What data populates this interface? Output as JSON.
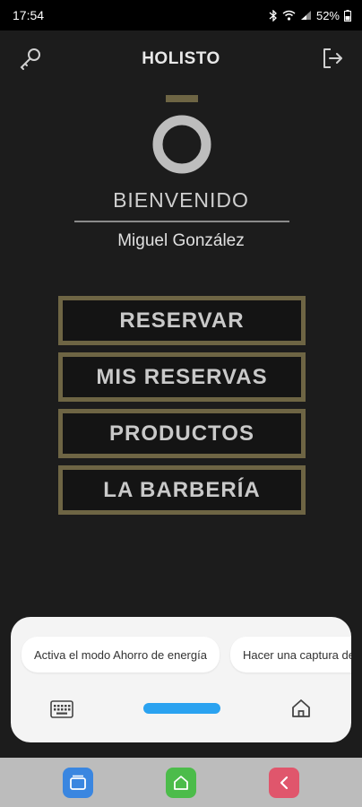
{
  "status_bar": {
    "time": "17:54",
    "battery": "52%",
    "icons": [
      "bluetooth-icon",
      "wifi-icon",
      "signal-icon",
      "battery-icon"
    ]
  },
  "app_bar": {
    "title": "HOLISTO",
    "left_icon": "key-icon",
    "right_icon": "logout-icon"
  },
  "brand": {
    "logo_icon": "holisto-logo",
    "accent_color": "#6e6544"
  },
  "welcome": {
    "heading": "BIENVENIDO",
    "user_name": "Miguel González"
  },
  "menu": {
    "items": [
      {
        "label": "RESERVAR"
      },
      {
        "label": "MIS RESERVAS"
      },
      {
        "label": "PRODUCTOS"
      },
      {
        "label": "LA BARBERÍA"
      }
    ]
  },
  "suggestion_panel": {
    "chips": [
      {
        "label": "Activa el modo Ahorro de energía"
      },
      {
        "label": "Hacer una captura de pantalla"
      }
    ],
    "keyboard_icon": "keyboard-icon",
    "home_icon": "home-icon"
  },
  "system_nav": {
    "buttons": [
      "recent-apps-icon",
      "home-icon",
      "back-icon"
    ]
  }
}
